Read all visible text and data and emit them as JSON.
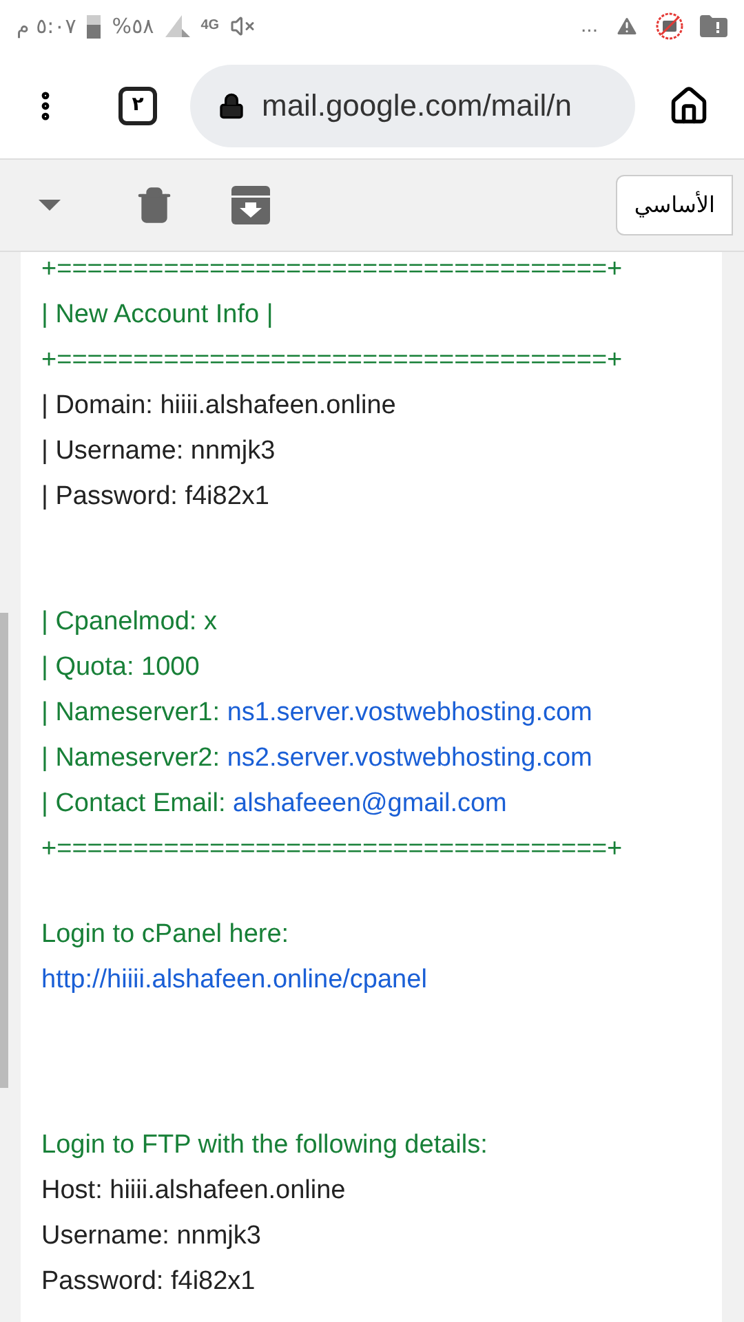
{
  "status_bar": {
    "time": "٥:٠٧ م",
    "battery": "%٥٨",
    "network": "4G",
    "more": "..."
  },
  "browser": {
    "tab_count": "٢",
    "url": "mail.google.com/mail/n"
  },
  "toolbar": {
    "label": "الأساسي"
  },
  "message": {
    "lines": [
      {
        "kind": "green",
        "text": "+====================================+"
      },
      {
        "kind": "green",
        "text": "| New Account Info |"
      },
      {
        "kind": "green",
        "text": "+====================================+"
      },
      {
        "kind": "dark",
        "text": "| Domain: hiiii.alshafeen.online"
      },
      {
        "kind": "dark",
        "text": "| Username: nnmjk3"
      },
      {
        "kind": "dark",
        "text": "| Password: f4i82x1"
      },
      {
        "kind": "blank"
      },
      {
        "kind": "blank"
      },
      {
        "kind": "green",
        "text": "| Cpanelmod: x"
      },
      {
        "kind": "green",
        "text": "| Quota: 1000"
      },
      {
        "kind": "pair",
        "label": "| Nameserver1:",
        "link": "ns1.server.vostwebhosting.com"
      },
      {
        "kind": "pair",
        "label": "| Nameserver2:",
        "link": "ns2.server.vostwebhosting.com"
      },
      {
        "kind": "pair",
        "label": "| Contact Email:",
        "link": "alshafeeen@gmail.com"
      },
      {
        "kind": "green",
        "text": "+====================================+"
      },
      {
        "kind": "blank"
      },
      {
        "kind": "green",
        "text": "Login to cPanel here:"
      },
      {
        "kind": "link",
        "text": "http://hiiii.alshafeen.online/cpanel"
      },
      {
        "kind": "blank"
      },
      {
        "kind": "blank"
      },
      {
        "kind": "blank"
      },
      {
        "kind": "green",
        "text": "Login to FTP with the following details:"
      },
      {
        "kind": "dark",
        "text": "Host: hiiii.alshafeen.online"
      },
      {
        "kind": "dark",
        "text": "Username: nnmjk3"
      },
      {
        "kind": "dark",
        "text": "Password: f4i82x1"
      }
    ]
  }
}
